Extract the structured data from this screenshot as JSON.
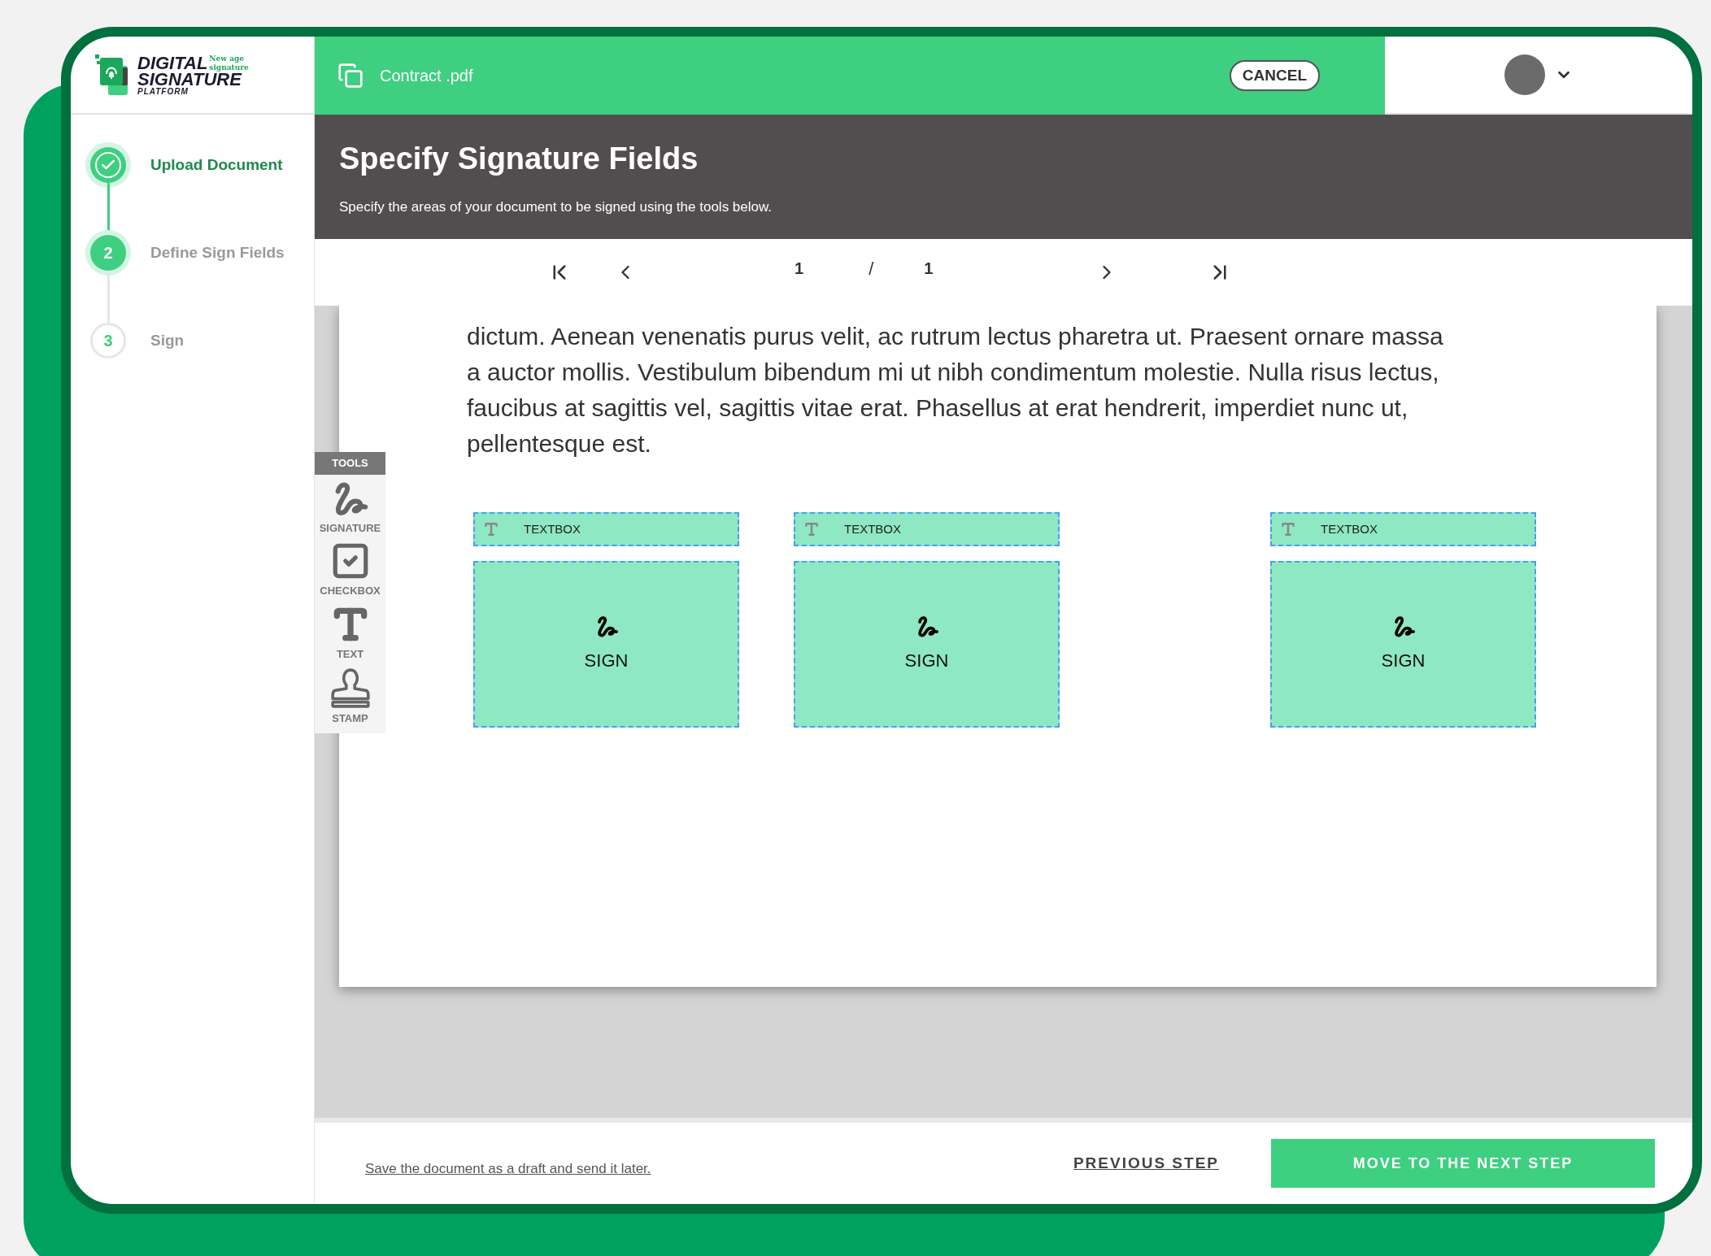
{
  "logo": {
    "line_1": "DIGITAL",
    "line_2": "SIGNATURE",
    "line_3": "PLATFORM",
    "tagline": "New age signature"
  },
  "steps": [
    {
      "label": "Upload Document",
      "kind": "done"
    },
    {
      "number": "2",
      "label": "Define Sign Fields",
      "kind": "current"
    },
    {
      "number": "3",
      "label": "Sign",
      "kind": "upcoming"
    }
  ],
  "top_bar": {
    "file_name": "Contract .pdf",
    "cancel": "CANCEL"
  },
  "header": {
    "title": "Specify Signature Fields",
    "subtitle": "Specify the areas of your document to be signed using the tools below."
  },
  "pager": {
    "current": "1",
    "separator": "/",
    "total": "1"
  },
  "document": {
    "paragraph": "dictum. Aenean venenatis purus velit, ac rutrum lectus pharetra ut. Praesent ornare massa a auctor mollis. Vestibulum bibendum mi ut nibh condimentum molestie. Nulla risus lectus, faucibus at sagittis vel, sagittis vitae erat. Phasellus at erat hendrerit, imperdiet nunc ut, pellentesque est.",
    "fields": [
      {
        "textbox": "TEXTBOX",
        "sign": "SIGN"
      },
      {
        "textbox": "TEXTBOX",
        "sign": "SIGN"
      },
      {
        "textbox": "TEXTBOX",
        "sign": "SIGN"
      }
    ]
  },
  "tools": {
    "title": "TOOLS",
    "items": [
      {
        "kind": "signature",
        "label": "SIGNATURE"
      },
      {
        "kind": "checkbox",
        "label": "CHECKBOX"
      },
      {
        "kind": "text",
        "label": "TEXT"
      },
      {
        "kind": "stamp",
        "label": "STAMP"
      }
    ]
  },
  "footer": {
    "draft_link": "Save the document as a draft and send it later.",
    "previous": "PREVIOUS STEP",
    "next": "MOVE TO THE NEXT STEP"
  }
}
